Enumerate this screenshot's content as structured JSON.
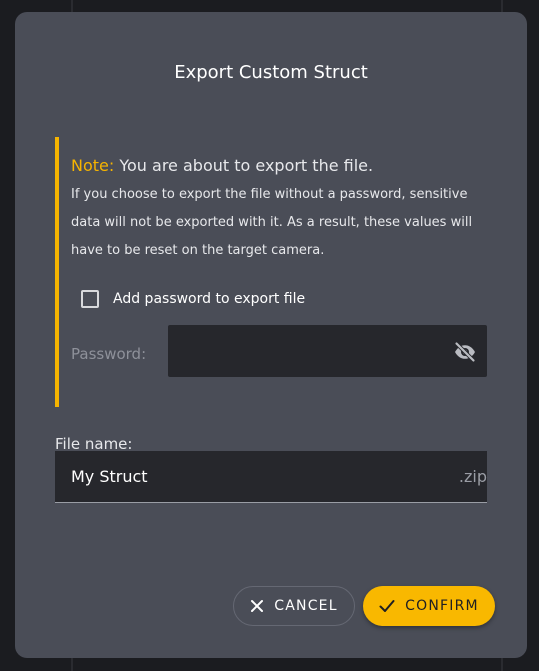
{
  "dialog": {
    "title": "Export Custom Struct",
    "note": {
      "label": "Note:",
      "headline": " You are about to export the file.",
      "description": "If you choose to export the file without a password, sensitive data will not be exported with it. As a result, these values will have to be reset on the target camera."
    },
    "password_checkbox": {
      "label": "Add password to export file",
      "checked": false
    },
    "password_field": {
      "label": "Password:",
      "value": "",
      "visibility_icon": "eye-off-icon"
    },
    "file_name": {
      "label": "File name:",
      "value": "My Struct",
      "extension": ".zip"
    },
    "buttons": {
      "cancel_label": "CANCEL",
      "confirm_label": "CONFIRM"
    }
  },
  "colors": {
    "accent": "#f6b400",
    "dialog_bg": "#4a4d57",
    "field_bg": "#26272c",
    "page_bg": "#1b1c20"
  }
}
